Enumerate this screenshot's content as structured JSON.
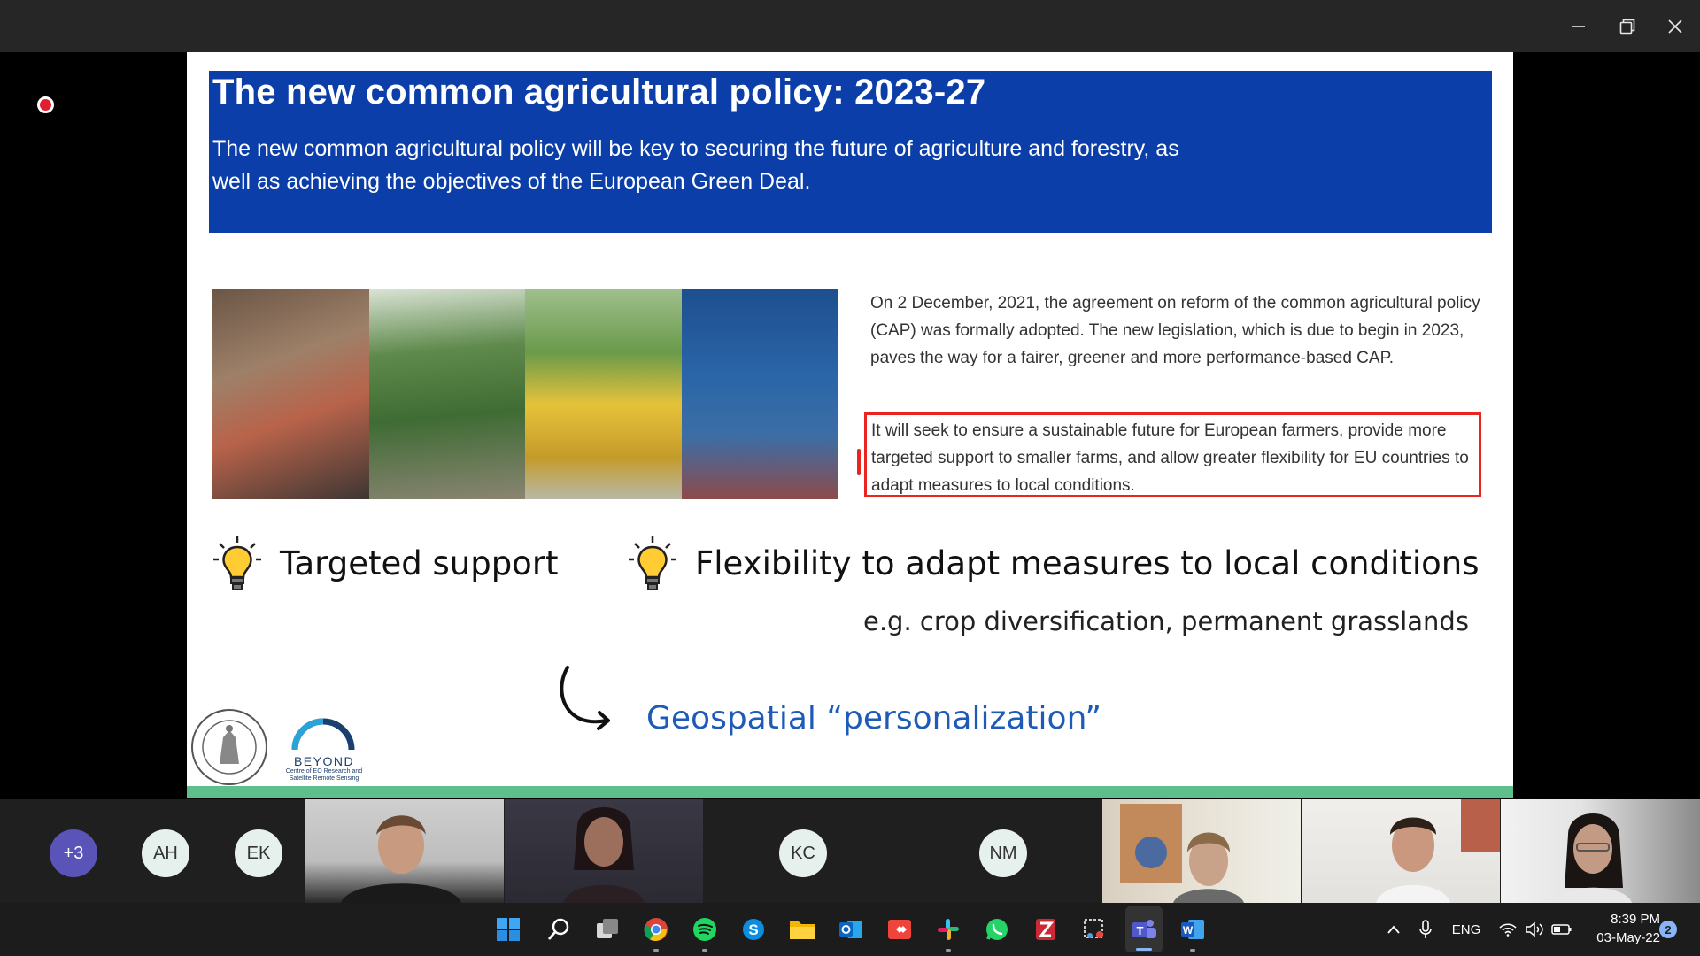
{
  "window": {
    "minimize_icon": "minimize-icon",
    "restore_icon": "restore-icon",
    "close_icon": "close-icon"
  },
  "recording": {
    "indicator_icon": "record-dot-icon",
    "color": "#e02030"
  },
  "slide": {
    "title": "The new common agricultural policy: 2023-27",
    "intro_line1": "The new common agricultural policy will be key to securing the future of agriculture and forestry, as",
    "intro_line2": "well as achieving the objectives of the European Green Deal.",
    "header_color": "#0b3ea8",
    "cap_paragraph": "On 2 December, 2021, the agreement on reform of the common agricultural policy (CAP) was formally adopted. The new legislation, which is due to begin in 2023, paves the way for a fairer, greener and more performance-based CAP.",
    "highlight_paragraph": "It will seek to ensure a sustainable future for European farmers, provide more targeted support to smaller farms, and allow greater flexibility for EU countries to adapt measures to local conditions.",
    "highlight_color": "#e8251f",
    "bullet1": "Targeted support",
    "bullet2": "Flexibility to adapt measures to local conditions",
    "example": "e.g. crop diversification, permanent grasslands",
    "geo": "Geospatial “personalization”",
    "geo_color": "#1e5bb8",
    "bulb_icon": "lightbulb-icon",
    "arrow_icon": "curved-arrow-icon",
    "logo_beyond_name": "BEYOND",
    "logo_beyond_sub": "Centre of EO Research and Satellite Remote Sensing",
    "footer_color": "#5fbf8c"
  },
  "participants": {
    "overflow": "+3",
    "initials": [
      "AH",
      "EK",
      "KC",
      "NM"
    ],
    "video_tiles": 5
  },
  "taskbar": {
    "apps": [
      "start-icon",
      "search-icon",
      "task-view-icon",
      "chrome-icon",
      "spotify-icon",
      "skype-icon",
      "file-explorer-icon",
      "outlook-icon",
      "anydesk-icon",
      "slack-icon",
      "whatsapp-icon",
      "zotero-icon",
      "snipping-tool-icon",
      "teams-icon",
      "word-icon"
    ],
    "language": "ENG",
    "time": "8:39 PM",
    "date": "03-May-22",
    "notifications": "2"
  }
}
